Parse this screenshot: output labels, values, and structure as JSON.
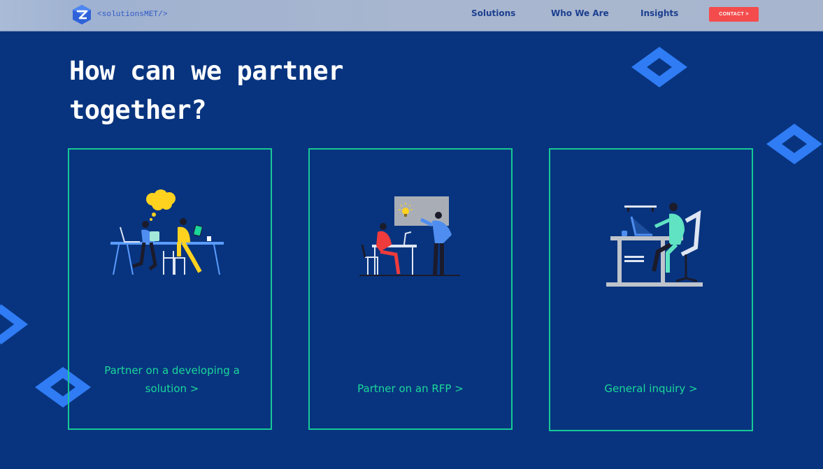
{
  "header": {
    "logo_text": "<solutionsMET/>",
    "nav": [
      "Solutions",
      "Who We Are",
      "Insights"
    ],
    "contact_label": "CONTACT >"
  },
  "hero": {
    "heading": "How can we partner together?"
  },
  "cards": [
    {
      "label": "Partner on a developing a solution >",
      "illustration": "team-brainstorm-illustration"
    },
    {
      "label": "Partner on an RFP >",
      "illustration": "presentation-idea-illustration"
    },
    {
      "label": "General inquiry >",
      "illustration": "person-at-desk-illustration"
    }
  ],
  "colors": {
    "background": "#08347f",
    "header": "#a8b6cf",
    "accent_green": "#1bd79a",
    "card_border": "#17c895",
    "contact_red": "#f44c4c",
    "diamond_blue": "#2f7cf4"
  }
}
